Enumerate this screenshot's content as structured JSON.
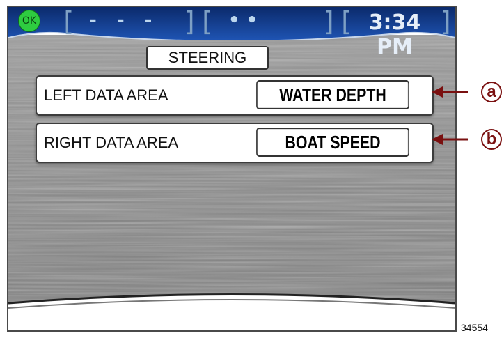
{
  "status_bar": {
    "ok_badge": "OK",
    "segment_left": "- - -",
    "segment_middle": "•   •",
    "time": "3:34 PM"
  },
  "screen_title": "STEERING",
  "data_areas": [
    {
      "label": "LEFT DATA AREA",
      "value": "WATER DEPTH",
      "callout": "a"
    },
    {
      "label": "RIGHT DATA AREA",
      "value": "BOAT SPEED",
      "callout": "b"
    }
  ],
  "figure_number": "34554",
  "colors": {
    "bar_top": "#0b2a6b",
    "bar_bottom": "#1f55b5",
    "brushed_metal": "#8f8f8f",
    "callout_arrow": "#7a1010",
    "ok_green": "#2ecc40"
  }
}
